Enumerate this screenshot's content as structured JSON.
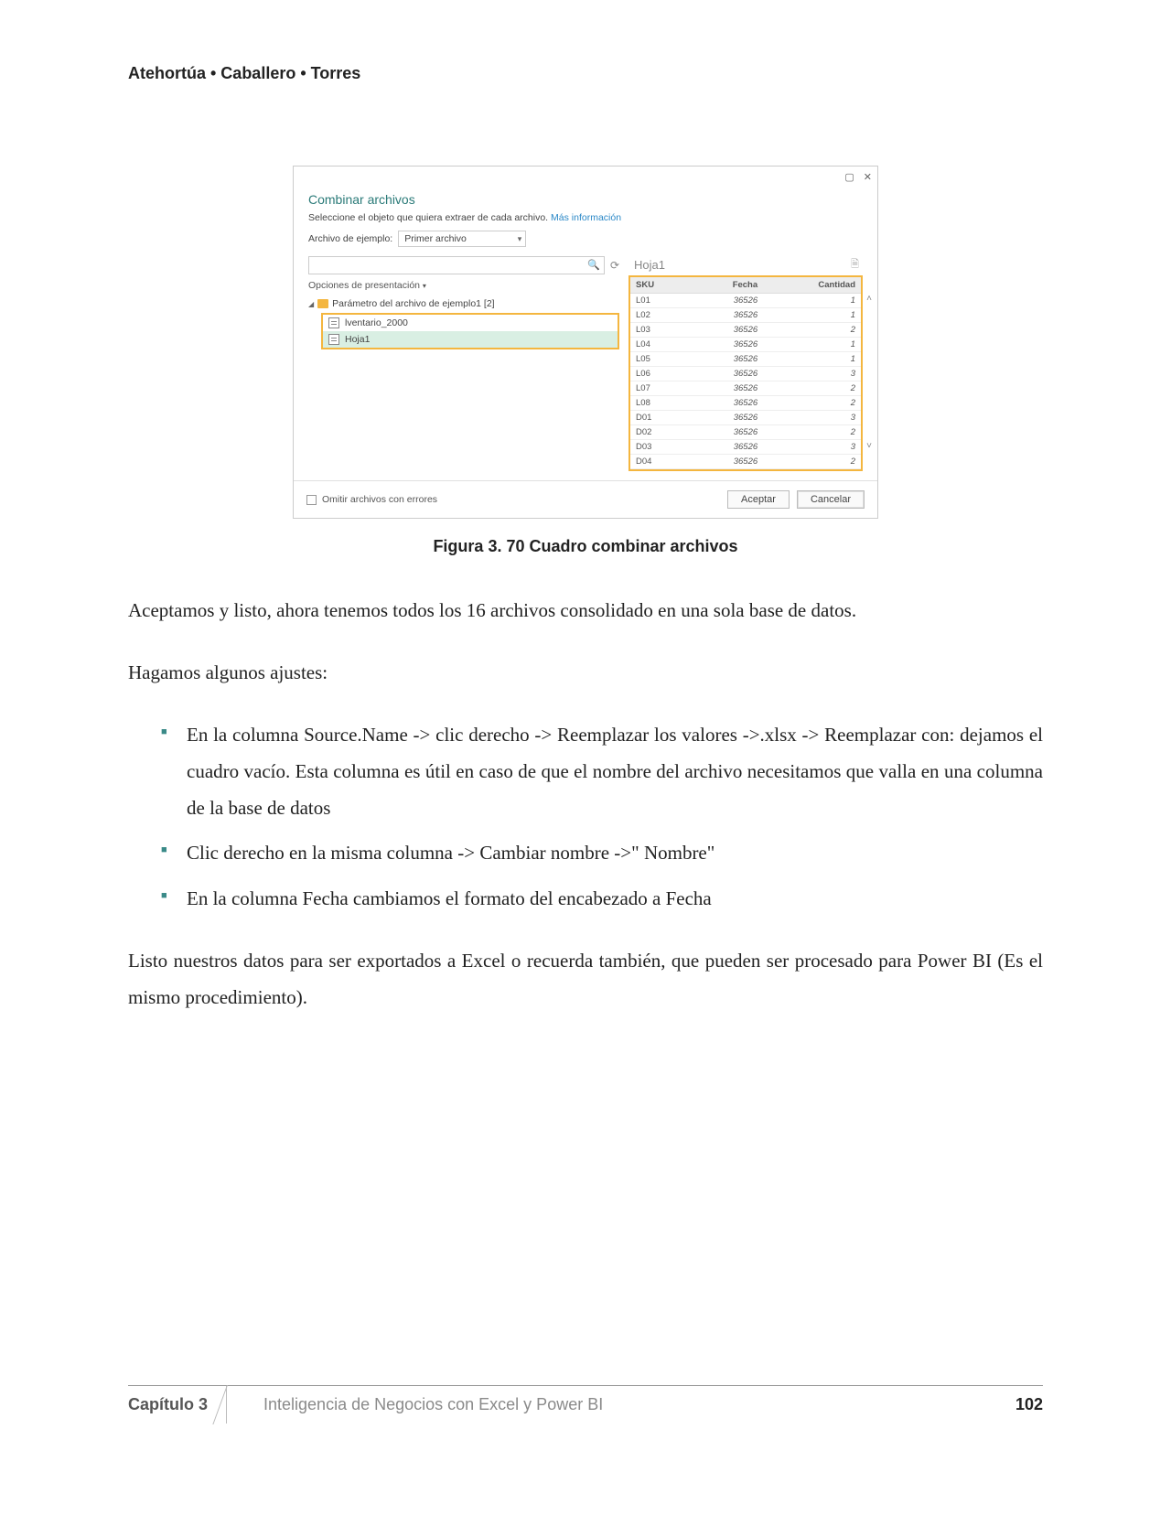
{
  "header": {
    "authors": "Atehortúa • Caballero • Torres"
  },
  "dialog": {
    "title": "Combinar archivos",
    "subtitle_pre": "Seleccione el objeto que quiera extraer de cada archivo. ",
    "subtitle_link": "Más información",
    "example_label": "Archivo de ejemplo:",
    "example_value": "Primer archivo",
    "options_label": "Opciones de presentación",
    "folder_label": "Parámetro del archivo de ejemplo1 [2]",
    "tree_item1": "lventario_2000",
    "tree_item2": "Hoja1",
    "preview_title": "Hoja1",
    "columns": [
      "SKU",
      "Fecha",
      "Cantidad"
    ],
    "rows": [
      [
        "L01",
        "36526",
        "1"
      ],
      [
        "L02",
        "36526",
        "1"
      ],
      [
        "L03",
        "36526",
        "2"
      ],
      [
        "L04",
        "36526",
        "1"
      ],
      [
        "L05",
        "36526",
        "1"
      ],
      [
        "L06",
        "36526",
        "3"
      ],
      [
        "L07",
        "36526",
        "2"
      ],
      [
        "L08",
        "36526",
        "2"
      ],
      [
        "D01",
        "36526",
        "3"
      ],
      [
        "D02",
        "36526",
        "2"
      ],
      [
        "D03",
        "36526",
        "3"
      ],
      [
        "D04",
        "36526",
        "2"
      ]
    ],
    "skip_errors": "Omitir archivos con errores",
    "accept": "Aceptar",
    "cancel": "Cancelar"
  },
  "figure_caption": "Figura 3. 70 Cuadro combinar archivos",
  "body": {
    "p1": "Aceptamos y listo, ahora tenemos todos los 16 archivos consolidado en una sola base de datos.",
    "p2": "Hagamos algunos ajustes:",
    "b1": "En la columna Source.Name -> clic derecho -> Reemplazar los valores ->.xlsx -> Reemplazar con: dejamos el cuadro vacío. Esta columna es útil en caso de que el nombre del archivo necesitamos que valla en una columna de la base de datos",
    "b2": "Clic derecho en la misma columna -> Cambiar nombre ->\" Nombre\"",
    "b3": "En la columna Fecha cambiamos el formato del encabezado a Fecha",
    "p3": "Listo nuestros datos para ser exportados a Excel o recuerda también, que pueden ser procesado para Power BI (Es el mismo procedimiento)."
  },
  "footer": {
    "chapter": "Capítulo 3",
    "book": "Inteligencia de Negocios con Excel y Power BI",
    "page": "102"
  }
}
